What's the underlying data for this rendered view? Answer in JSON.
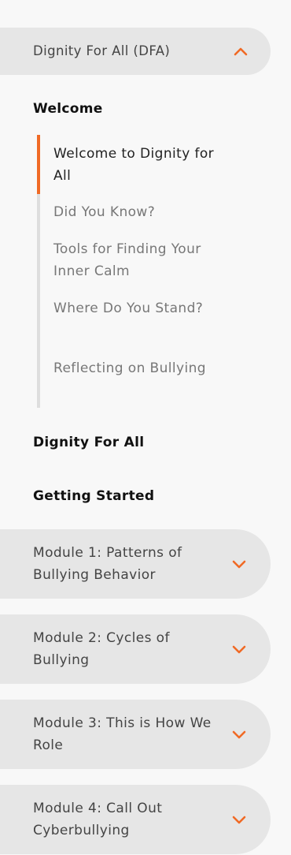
{
  "accent_color": "#f06a25",
  "course": {
    "title": "Dignity For All (DFA)",
    "expanded_icon": "chevron-up-icon"
  },
  "sections": [
    {
      "label": "Welcome",
      "items": [
        {
          "label": "Welcome to Dignity for All",
          "active": true
        },
        {
          "label": "Did You Know?",
          "active": false
        },
        {
          "label": "Tools for Finding Your Inner Calm",
          "active": false
        },
        {
          "label": "Where Do You Stand?",
          "active": false
        },
        {
          "label": "Reflecting on Bullying",
          "active": false
        }
      ]
    },
    {
      "label": "Dignity For All"
    },
    {
      "label": "Getting Started"
    }
  ],
  "modules": [
    {
      "label": "Module 1: Patterns of Bullying Behavior",
      "icon": "chevron-down-icon"
    },
    {
      "label": "Module 2: Cycles of Bullying",
      "icon": "chevron-down-icon"
    },
    {
      "label": "Module 3: This is How We Role",
      "icon": "chevron-down-icon"
    },
    {
      "label": "Module 4: Call Out Cyberbullying",
      "icon": "chevron-down-icon"
    }
  ]
}
